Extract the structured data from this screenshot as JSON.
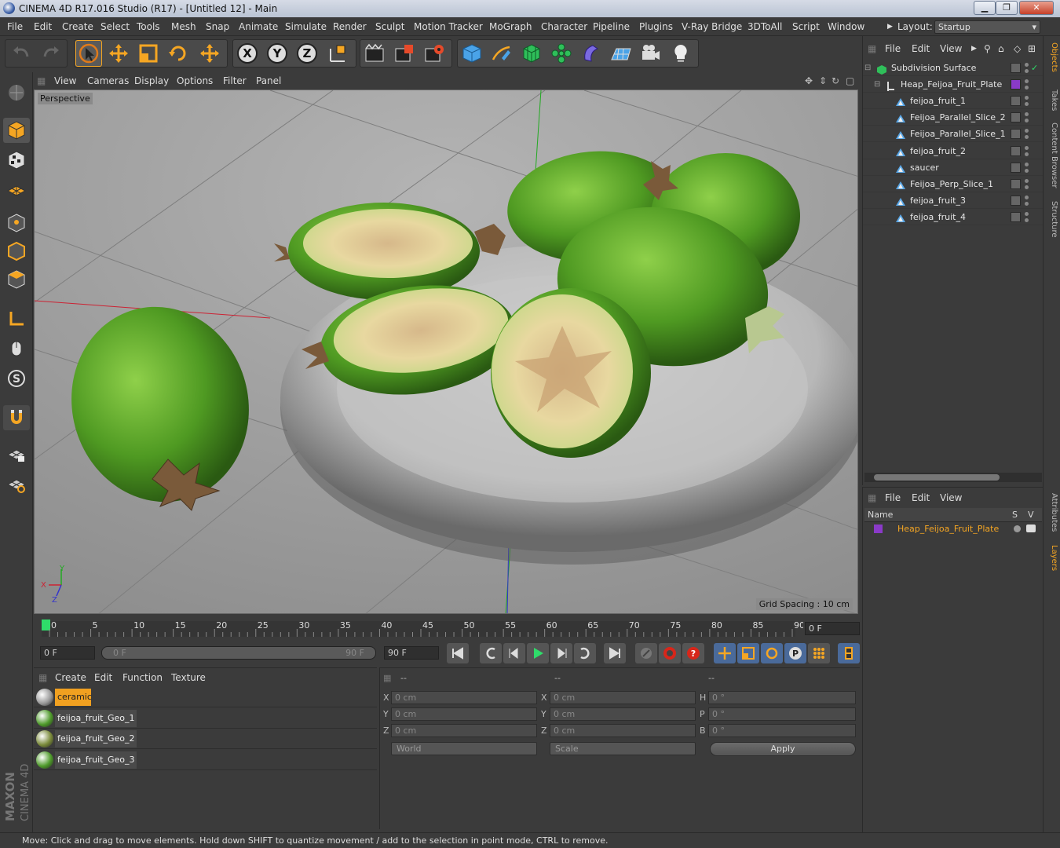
{
  "window": {
    "title": "CINEMA 4D R17.016 Studio (R17) - [Untitled 12] - Main"
  },
  "menu": {
    "items": [
      "File",
      "Edit",
      "Create",
      "Select",
      "Tools",
      "Mesh",
      "Snap",
      "Animate",
      "Simulate",
      "Render",
      "Sculpt",
      "Motion Tracker",
      "MoGraph",
      "Character",
      "Pipeline",
      "Plugins",
      "V-Ray Bridge",
      "3DToAll",
      "Script",
      "Window"
    ],
    "layout_label": "Layout:",
    "layout_value": "Startup"
  },
  "viewport": {
    "menu": [
      "View",
      "Cameras",
      "Display",
      "Options",
      "Filter",
      "Panel"
    ],
    "camera": "Perspective",
    "grid_spacing": "Grid Spacing : 10 cm",
    "axis_y": "Y",
    "axis_x": "X",
    "axis_z": "Z"
  },
  "timeline": {
    "ticks": [
      "0",
      "5",
      "10",
      "15",
      "20",
      "25",
      "30",
      "35",
      "40",
      "45",
      "50",
      "55",
      "60",
      "65",
      "70",
      "75",
      "80",
      "85",
      "90"
    ],
    "current_frame": "0 F"
  },
  "transport": {
    "start_frame": "0 F",
    "range_start": "0 F",
    "range_end": "90 F",
    "end_frame": "90 F"
  },
  "material_manager": {
    "menu": [
      "Create",
      "Edit",
      "Function",
      "Texture"
    ],
    "materials": [
      {
        "name": "ceramic",
        "color": "#9a9a9a",
        "selected": true
      },
      {
        "name": "feijoa_fruit_Geo_1",
        "color": "#4e9a2a",
        "selected": false
      },
      {
        "name": "feijoa_fruit_Geo_2",
        "color": "#7a8a3a",
        "selected": false
      },
      {
        "name": "feijoa_fruit_Geo_3",
        "color": "#4e9a2a",
        "selected": false
      }
    ]
  },
  "coordinates": {
    "header": [
      "--",
      "--",
      "--"
    ],
    "pos_labels": [
      "X",
      "Y",
      "Z"
    ],
    "pos_values": [
      "0 cm",
      "0 cm",
      "0 cm"
    ],
    "size_labels": [
      "X",
      "Y",
      "Z"
    ],
    "size_values": [
      "0 cm",
      "0 cm",
      "0 cm"
    ],
    "rot_labels": [
      "H",
      "P",
      "B"
    ],
    "rot_values": [
      "0 °",
      "0 °",
      "0 °"
    ],
    "mode": "World",
    "scale_mode": "Scale",
    "apply": "Apply"
  },
  "object_manager": {
    "menu": [
      "File",
      "Edit",
      "View"
    ],
    "objects": [
      {
        "name": "Subdivision Surface",
        "level": 0
      },
      {
        "name": "Heap_Feijoa_Fruit_Plate",
        "level": 1
      },
      {
        "name": "feijoa_fruit_1",
        "level": 2
      },
      {
        "name": "Feijoa_Parallel_Slice_2",
        "level": 2
      },
      {
        "name": "Feijoa_Parallel_Slice_1",
        "level": 2
      },
      {
        "name": "feijoa_fruit_2",
        "level": 2
      },
      {
        "name": "saucer",
        "level": 2
      },
      {
        "name": "Feijoa_Perp_Slice_1",
        "level": 2
      },
      {
        "name": "feijoa_fruit_3",
        "level": 2
      },
      {
        "name": "feijoa_fruit_4",
        "level": 2
      }
    ]
  },
  "layer_manager": {
    "menu": [
      "File",
      "Edit",
      "View"
    ],
    "col_name": "Name",
    "col_s": "S",
    "col_v": "V",
    "layers": [
      {
        "name": "Heap_Feijoa_Fruit_Plate",
        "color": "#8a3ac8"
      }
    ]
  },
  "side_tabs": [
    "Objects",
    "Takes",
    "Content Browser",
    "Structure",
    "Attributes",
    "Layers"
  ],
  "branding": {
    "maxon": "MAXON",
    "product": "CINEMA 4D"
  },
  "status": "Move: Click and drag to move elements. Hold down SHIFT to quantize movement / add to the selection in point mode, CTRL to remove.",
  "colors": {
    "accent": "#f5a623",
    "selected_bg": "#f0a020",
    "layer_text": "#f5a623"
  }
}
